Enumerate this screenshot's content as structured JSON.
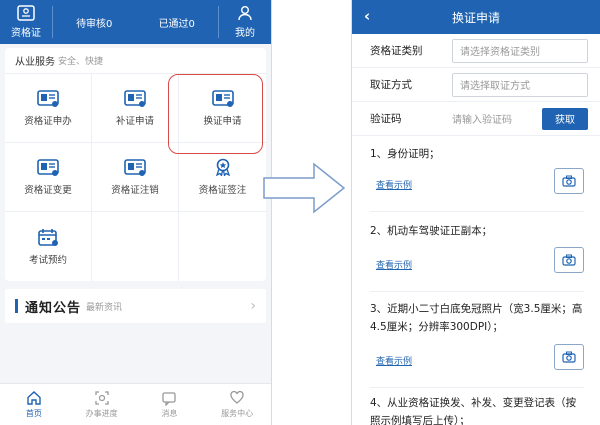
{
  "left": {
    "topbar": {
      "cert_label": "资格证",
      "pending_label": "待审核0",
      "passed_label": "已通过0",
      "mine_label": "我的"
    },
    "services": {
      "title": "从业服务",
      "subtitle": "安全、快捷",
      "items": [
        {
          "label": "资格证申办",
          "icon": "id-card-icon"
        },
        {
          "label": "补证申请",
          "icon": "id-card-icon"
        },
        {
          "label": "换证申请",
          "icon": "id-card-icon"
        },
        {
          "label": "资格证变更",
          "icon": "id-card-icon"
        },
        {
          "label": "资格证注销",
          "icon": "id-card-icon"
        },
        {
          "label": "资格证签注",
          "icon": "badge-icon"
        },
        {
          "label": "考试预约",
          "icon": "calendar-icon"
        }
      ]
    },
    "notice": {
      "title": "通知公告",
      "subtitle": "最新资讯"
    },
    "bottom_nav": [
      {
        "label": "首页",
        "active": true
      },
      {
        "label": "办事进度",
        "active": false
      },
      {
        "label": "消息",
        "active": false
      },
      {
        "label": "服务中心",
        "active": false
      }
    ],
    "accent": "#1f63b2",
    "highlight": "#d94b4b"
  },
  "right": {
    "header": {
      "title": "换证申请",
      "back_glyph": "‹"
    },
    "form": {
      "cert_type_label": "资格证类别",
      "cert_type_placeholder": "请选择资格证类别",
      "pickup_label": "取证方式",
      "pickup_placeholder": "请选择取证方式",
      "code_label": "验证码",
      "code_placeholder": "请输入验证码",
      "get_button": "获取"
    },
    "documents": [
      {
        "title_lines": [
          "1、身份证明；"
        ],
        "example": "查看示例"
      },
      {
        "title_lines": [
          "2、机动车驾驶证正副本；"
        ],
        "example": "查看示例"
      },
      {
        "title_lines": [
          "3、近期小二寸白底免冠照片（宽3.5厘米；高",
          "4.5厘米；分辨率300DPI）；"
        ],
        "example": "查看示例"
      },
      {
        "title_lines": [
          "4、从业资格证换发、补发、变更登记表（按",
          "照示例填写后上传）；"
        ],
        "example": ""
      }
    ]
  }
}
